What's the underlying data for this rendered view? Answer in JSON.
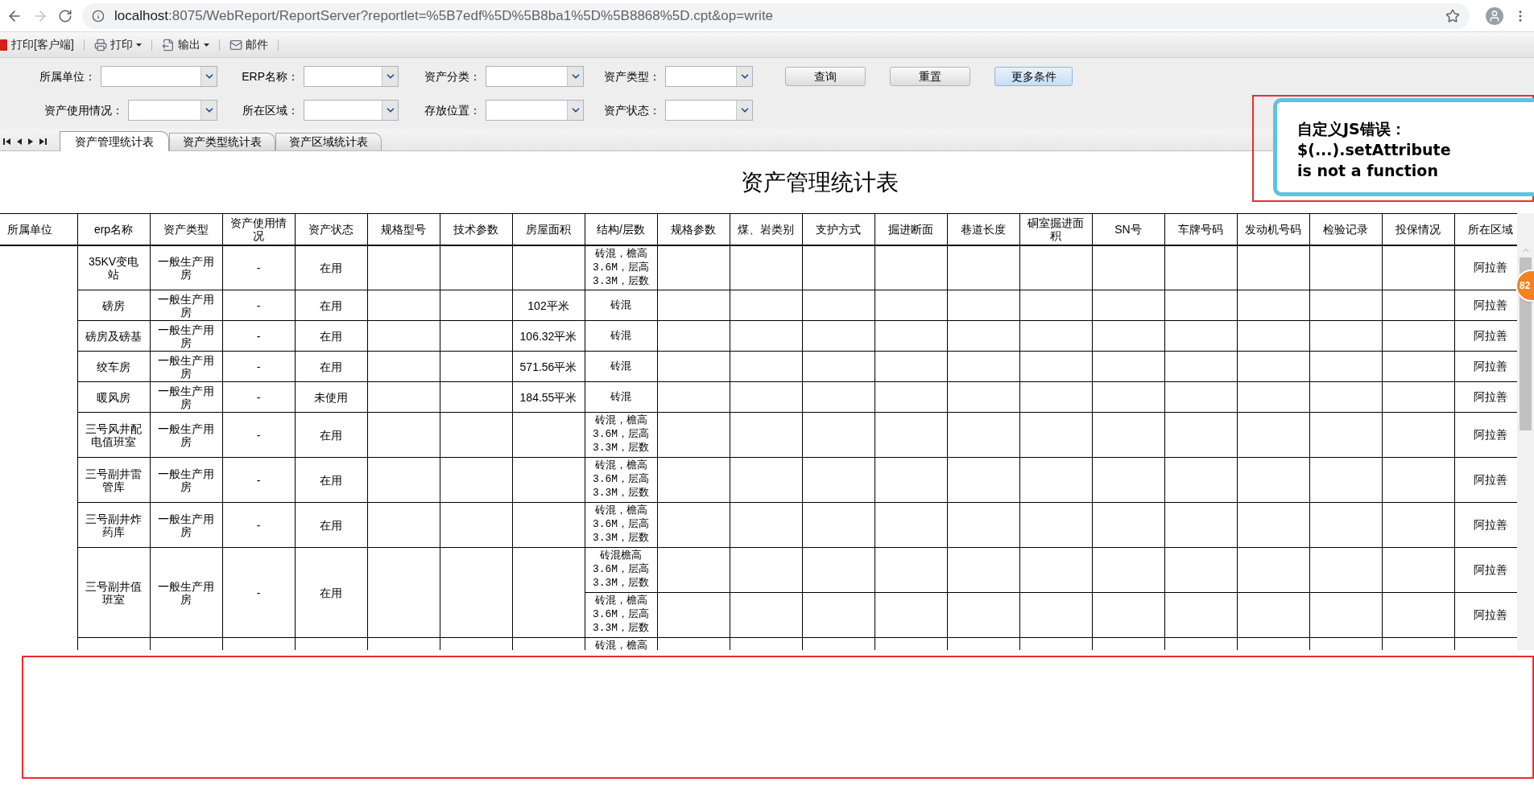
{
  "browser": {
    "url": {
      "host": "localhost",
      "path": ":8075/WebReport/ReportServer?reportlet=%5B7edf%5D%5B8ba1%5D%5B8868%5D.cpt&op=write"
    },
    "forward_disabled": true
  },
  "toolbar": [
    {
      "kind": "client-print",
      "label": "打印[客户端]",
      "menu": false
    },
    {
      "kind": "print",
      "label": "打印",
      "menu": true
    },
    {
      "kind": "export",
      "label": "输出",
      "menu": true
    },
    {
      "kind": "mail",
      "label": "邮件",
      "menu": false
    }
  ],
  "filters": [
    [
      {
        "label": "所属单位："
      },
      {
        "label": "ERP名称："
      },
      {
        "label": "资产分类："
      },
      {
        "label": "资产类型："
      }
    ],
    [
      {
        "label": "资产使用情况："
      },
      {
        "label": "所在区域："
      },
      {
        "label": "存放位置："
      },
      {
        "label": "资产状态："
      }
    ]
  ],
  "buttons": [
    {
      "label": "查询",
      "primary": false
    },
    {
      "label": "重置",
      "primary": false
    },
    {
      "label": "更多条件",
      "primary": true
    }
  ],
  "sheet_tabs": [
    {
      "label": "资产管理统计表",
      "selected": true
    },
    {
      "label": "资产类型统计表",
      "selected": false
    },
    {
      "label": "资产区域统计表",
      "selected": false
    }
  ],
  "report_title": "资产管理统计表",
  "table": {
    "columns": [
      "所属单位",
      "erp名称",
      "资产类型",
      "资产使用情况",
      "资产状态",
      "规格型号",
      "技术参数",
      "房屋面积",
      "结构/层数",
      "规格参数",
      "煤、岩类别",
      "支护方式",
      "掘进断面",
      "巷道长度",
      "硐室掘进面积",
      "SN号",
      "车牌号码",
      "发动机号码",
      "检验记录",
      "投保情况",
      "所在区域"
    ],
    "rows": [
      {
        "erp": "35KV变电站",
        "type": "一般生产用房",
        "usage": "-",
        "status": "在用",
        "lines": [
          {
            "structure": "砖混，檐高\n3.6M，层高\n3.3M，层数",
            "region": "阿拉善"
          }
        ]
      },
      {
        "erp": "磅房",
        "type": "一般生产用房",
        "usage": "-",
        "status": "在用",
        "area": "102平米",
        "lines": [
          {
            "structure": "砖混",
            "region": "阿拉善"
          }
        ]
      },
      {
        "erp": "磅房及磅基",
        "type": "一般生产用房",
        "usage": "-",
        "status": "在用",
        "area": "106.32平米",
        "lines": [
          {
            "structure": "砖混",
            "region": "阿拉善"
          }
        ]
      },
      {
        "erp": "绞车房",
        "type": "一般生产用房",
        "usage": "-",
        "status": "在用",
        "area": "571.56平米",
        "lines": [
          {
            "structure": "砖混",
            "region": "阿拉善"
          }
        ]
      },
      {
        "erp": "暖风房",
        "type": "一般生产用房",
        "usage": "-",
        "status": "未使用",
        "area": "184.55平米",
        "lines": [
          {
            "structure": "砖混",
            "region": "阿拉善"
          }
        ]
      },
      {
        "erp": "三号风井配电值班室",
        "type": "一般生产用房",
        "usage": "-",
        "status": "在用",
        "lines": [
          {
            "structure": "砖混，檐高\n3.6M，层高\n3.3M，层数",
            "region": "阿拉善"
          }
        ]
      },
      {
        "erp": "三号副井雷管库",
        "type": "一般生产用房",
        "usage": "-",
        "status": "在用",
        "lines": [
          {
            "structure": "砖混，檐高\n3.6M，层高\n3.3M，层数",
            "region": "阿拉善"
          }
        ]
      },
      {
        "erp": "三号副井炸药库",
        "type": "一般生产用房",
        "usage": "-",
        "status": "在用",
        "lines": [
          {
            "structure": "砖混，檐高\n3.6M，层高\n3.3M，层数",
            "region": "阿拉善"
          }
        ]
      },
      {
        "erp": "三号副井值班室",
        "type": "一般生产用房",
        "usage": "-",
        "status": "在用",
        "lines": [
          {
            "structure": "砖混檐高\n3.6M，层高\n3.3M，层数",
            "region": "阿拉善"
          },
          {
            "structure": "砖混，檐高\n3.6M，层高\n3.3M，层数",
            "region": "阿拉善"
          }
        ]
      },
      {
        "lines": [
          {
            "structure": "砖混，檐高"
          }
        ]
      }
    ]
  },
  "badge": "82",
  "error_popup": {
    "title": "自定义JS错误：",
    "message": "$(...).setAttribute is not a function"
  }
}
